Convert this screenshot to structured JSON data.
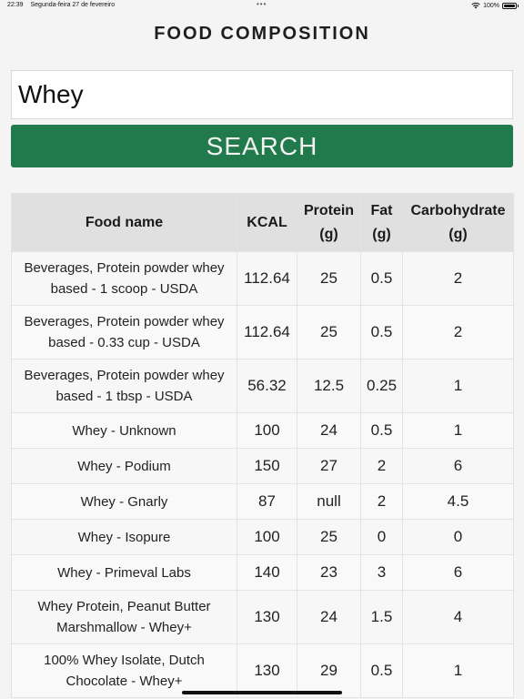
{
  "status_bar": {
    "time": "22:39",
    "date": "Segunda-feira 27 de fevereiro",
    "dots": "•••",
    "battery": "100%",
    "icons": [
      "wifi-icon",
      "battery-icon"
    ]
  },
  "title": "FOOD COMPOSITION",
  "search": {
    "value": "Whey",
    "button_label": "SEARCH"
  },
  "colors": {
    "accent": "#217a4b",
    "header_bg": "#e0e0e0"
  },
  "table": {
    "headers": {
      "name": "Food name",
      "kcal": "KCAL",
      "protein": "Protein (g)",
      "fat": "Fat (g)",
      "carbs": "Carbohydrate (g)"
    },
    "rows": [
      {
        "name": "Beverages, Protein powder whey based - 1 scoop - USDA",
        "kcal": "112.64",
        "protein": "25",
        "fat": "0.5",
        "carbs": "2"
      },
      {
        "name": "Beverages, Protein powder whey based - 0.33 cup - USDA",
        "kcal": "112.64",
        "protein": "25",
        "fat": "0.5",
        "carbs": "2"
      },
      {
        "name": "Beverages, Protein powder whey based - 1 tbsp - USDA",
        "kcal": "56.32",
        "protein": "12.5",
        "fat": "0.25",
        "carbs": "1"
      },
      {
        "name": "Whey - Unknown",
        "kcal": "100",
        "protein": "24",
        "fat": "0.5",
        "carbs": "1"
      },
      {
        "name": "Whey - Podium",
        "kcal": "150",
        "protein": "27",
        "fat": "2",
        "carbs": "6"
      },
      {
        "name": "Whey - Gnarly",
        "kcal": "87",
        "protein": "null",
        "fat": "2",
        "carbs": "4.5"
      },
      {
        "name": "Whey - Isopure",
        "kcal": "100",
        "protein": "25",
        "fat": "0",
        "carbs": "0"
      },
      {
        "name": "Whey - Primeval Labs",
        "kcal": "140",
        "protein": "23",
        "fat": "3",
        "carbs": "6"
      },
      {
        "name": "Whey Protein, Peanut Butter Marshmallow - Whey+",
        "kcal": "130",
        "protein": "24",
        "fat": "1.5",
        "carbs": "4"
      },
      {
        "name": "100% Whey Isolate, Dutch Chocolate - Whey+",
        "kcal": "130",
        "protein": "29",
        "fat": "0.5",
        "carbs": "1"
      }
    ]
  }
}
